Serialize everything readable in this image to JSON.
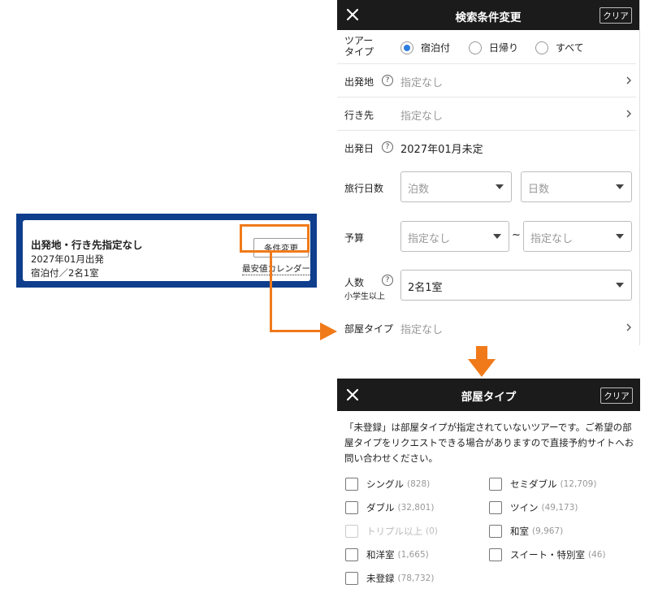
{
  "summary": {
    "title": "出発地・行き先指定なし",
    "date": "2027年01月出発",
    "stay": "宿泊付／2名1室",
    "change_button": "条件変更",
    "calendar_link": "最安値カレンダー"
  },
  "search_panel": {
    "title": "検索条件変更",
    "clear": "クリア",
    "tour_type": {
      "label_line1": "ツアー",
      "label_line2": "タイプ",
      "options": [
        "宿泊付",
        "日帰り",
        "すべて"
      ],
      "selected": "宿泊付"
    },
    "departure": {
      "label": "出発地",
      "value": "指定なし"
    },
    "destination": {
      "label": "行き先",
      "value": "指定なし"
    },
    "departure_date": {
      "label": "出発日",
      "value": "2027年01月未定"
    },
    "duration": {
      "label": "旅行日数",
      "nights_placeholder": "泊数",
      "days_placeholder": "日数"
    },
    "budget": {
      "label": "予算",
      "min": "指定なし",
      "separator": "~",
      "max": "指定なし"
    },
    "people": {
      "label": "人数",
      "sublabel": "小学生以上",
      "value": "2名1室"
    },
    "room_type": {
      "label": "部屋タイプ",
      "value": "指定なし"
    }
  },
  "room_panel": {
    "title": "部屋タイプ",
    "clear": "クリア",
    "description": "「未登録」は部屋タイプが指定されていないツアーです。ご希望の部屋タイプをリクエストできる場合がありますので直接予約サイトへお問い合わせください。",
    "options": [
      {
        "label": "シングル",
        "count": "(828)",
        "disabled": false
      },
      {
        "label": "セミダブル",
        "count": "(12,709)",
        "disabled": false
      },
      {
        "label": "ダブル",
        "count": "(32,801)",
        "disabled": false
      },
      {
        "label": "ツイン",
        "count": "(49,173)",
        "disabled": false
      },
      {
        "label": "トリプル以上",
        "count": "(0)",
        "disabled": true
      },
      {
        "label": "和室",
        "count": "(9,967)",
        "disabled": false
      },
      {
        "label": "和洋室",
        "count": "(1,665)",
        "disabled": false
      },
      {
        "label": "スイート・特別室",
        "count": "(46)",
        "disabled": false
      },
      {
        "label": "未登録",
        "count": "(78,732)",
        "disabled": false
      }
    ]
  },
  "colors": {
    "highlight": "#f07a1a",
    "frame": "#0e3e8c",
    "header": "#1b1b1b",
    "radio_selected": "#2c7de0"
  }
}
